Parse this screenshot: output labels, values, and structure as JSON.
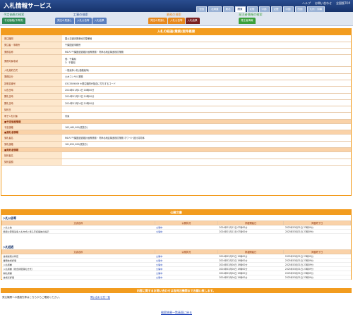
{
  "header": {
    "title": "入札情報サービス",
    "links": [
      "ヘルプ",
      "お問い合わせ",
      "全国版TOP"
    ],
    "regions": [
      "全国",
      "北海道",
      "東北",
      "関東",
      "北陸",
      "中部",
      "近畿",
      "中国",
      "四国",
      "九州・沖縄"
    ],
    "active_region": "関東"
  },
  "nav": {
    "groups": [
      {
        "title": "予定価格の検索",
        "tabs": [
          {
            "label": "予定価格(予算書)",
            "color": "#2e8b57"
          }
        ]
      },
      {
        "title": "工事の検索",
        "tabs": [
          {
            "label": "発注の見通し",
            "color": "#5a7fbf"
          },
          {
            "label": "入札公告等",
            "color": "#5a7fbf"
          },
          {
            "label": "入札結果",
            "color": "#5a7fbf"
          }
        ]
      },
      {
        "title": "業務の検索",
        "tabs": [
          {
            "label": "発注の見通し",
            "color": "#e8891c"
          },
          {
            "label": "入札公告等",
            "color": "#e8891c"
          },
          {
            "label": "入札結果",
            "color": "#7a1f1f"
          }
        ]
      },
      {
        "title": "発注者情報の検索",
        "tabs": [
          {
            "label": "発注者情報",
            "color": "#3aa03a"
          }
        ]
      }
    ]
  },
  "main": {
    "heading": "入札の経過(業務)案件概要",
    "rows": [
      {
        "label": "発注機関",
        "value": "国土交通省関東地方整備局"
      },
      {
        "label": "発注者・事務所",
        "value": "千葉国道事務所"
      },
      {
        "label": "業務名称",
        "value": "R6-R7千葉国道道路計画等業務・湾岸北地区構造検討業務"
      },
      {
        "label": "業務対象地域",
        "value": "他：千葉県\n3：千葉県",
        "tall": true
      },
      {
        "label": "入札契約方式",
        "value": "一般競争入札(価格競争)"
      },
      {
        "label": "業務区分",
        "value": "土木コンサル業務"
      },
      {
        "label": "説明書番号",
        "value": "0313309009  ※発注機関が独自に付与するコード"
      },
      {
        "label": "公告日時",
        "value": "2024年01月11日 18時00分"
      },
      {
        "label": "開札日時",
        "value": "2024年02月22日 10時00分"
      },
      {
        "label": "開札日時",
        "value": "2024年03月04日 10時00分"
      },
      {
        "label": "契約日",
        "value": ""
      },
      {
        "label": "電子入札対象",
        "value": "対象"
      },
      {
        "section": "■予定価格情報"
      },
      {
        "label": "予定価格",
        "value": "163,460,000(税抜き)"
      },
      {
        "section": "■落札者情報"
      },
      {
        "label": "落札者名",
        "value": "R6-R7千葉国道道路計画等業務・湾岸北地区構造検討業務 ホワイト設計共同体"
      },
      {
        "label": "落札価格",
        "value": "161,820,000(税抜き)"
      },
      {
        "section": "■契約者情報"
      },
      {
        "label": "契約者名",
        "value": ""
      },
      {
        "label": "契約金額",
        "value": ""
      }
    ]
  },
  "documents": {
    "heading": "公開文書",
    "columns": [
      "文書名称",
      "公開状況",
      "掲載開始日",
      "掲載終了日"
    ],
    "sections": [
      {
        "title": "入札公告等",
        "rows": [
          [
            "入札公告",
            "公開中",
            "2024年01月11日 07時00分",
            "2025年03月31日 23時59分"
          ],
          [
            "簡易公募型競争入札方式に係る手続開始の掲示",
            "公開中",
            "2024年01月11日 07時00分",
            "2025年03月31日 23時59分"
          ]
        ]
      },
      {
        "title": "入札経過",
        "rows": [
          [
            "技術提案の特定",
            "公開中",
            "2024年02月22日 19時00分",
            "2025年03月31日 23時59分"
          ],
          [
            "業務技術評価",
            "公開中",
            "2024年02月22日 19時00分",
            "2025年03月31日 23時59分"
          ],
          [
            "入札調書",
            "公開中",
            "2024年03月04日 19時00分",
            "2025年03月31日 23時59分"
          ],
          [
            "入札調書（総合評価落札方式）",
            "公開中",
            "2024年03月04日 19時00分",
            "2025年03月31日 23時59分"
          ],
          [
            "開札調書",
            "公開中",
            "2024年03月04日 19時00分",
            "2025年03月31日 23時59分"
          ],
          [
            "技術点評価",
            "公開中",
            "2024年03月04日 19時00分",
            "2025年03月31日 23時59分"
          ]
        ]
      }
    ]
  },
  "inquiry": {
    "heading": "内容に関するお問い合わせは各発注機関までお願い致します。",
    "text": "発注機関への連絡先等はこちらからご確認ください。",
    "link": "問い合わせ先一覧"
  },
  "back_link": "検索結果一覧画面に戻る"
}
